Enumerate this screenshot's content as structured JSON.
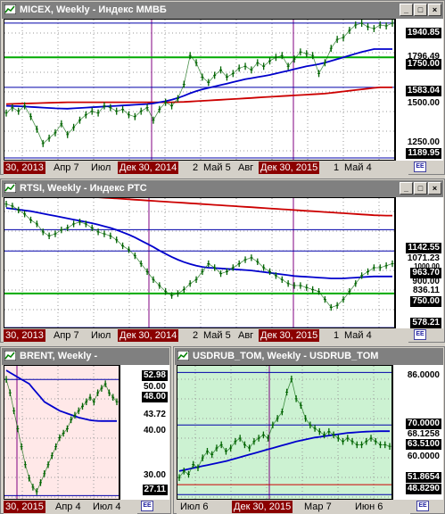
{
  "colors": {
    "title_bg_inactive": "#7f7f7f",
    "title_bg_active": "#7f7f7f",
    "plot_bg_white": "#ffffff",
    "plot_bg_pink": "#ffe8e8",
    "plot_bg_green": "#ccf2d2",
    "price": "#006400",
    "ma_blue": "#0000cc",
    "ma_red": "#cc0000",
    "level_green": "#00aa00",
    "level_blue": "#0000aa",
    "date_highlight": "#8b0000"
  },
  "window_buttons": {
    "minimize": "_",
    "maximize": "□",
    "close": "×"
  },
  "windows": {
    "micex": {
      "title": "MICEX, Weekly - Индекс ММВБ",
      "y_labels": [
        "1940.85",
        "1796.49",
        "1750.00",
        "1583.04",
        "1500.00",
        "1250.00",
        "1189.95"
      ],
      "x_labels": [
        "30, 2013",
        "Апр 7",
        "Июл",
        "Дек 30, 2014",
        "2",
        "Май 5",
        "Авг",
        "Дек 30, 2015",
        "1",
        "Май 4"
      ],
      "x_highlight": [
        0,
        3,
        7
      ],
      "corner_icon": "chart-settings-icon"
    },
    "rtsi": {
      "title": "RTSI, Weekly - Индекс РТС",
      "y_labels": [
        "1142.55",
        "1071.23",
        "1000.00",
        "963.70",
        "900.00",
        "836.11",
        "750.00",
        "578.21"
      ],
      "x_labels": [
        "30, 2013",
        "Апр 7",
        "Июл",
        "Дек 30, 2014",
        "2",
        "Май 5",
        "Авг",
        "Дек 30, 2015",
        "1",
        "Май 4"
      ],
      "x_highlight": [
        0,
        3,
        7
      ],
      "corner_icon": "chart-settings-icon"
    },
    "brent": {
      "title": "BRENT, Weekly -",
      "y_labels": [
        "52.98",
        "50.00",
        "48.00",
        "43.72",
        "40.00",
        "30.00",
        "27.11"
      ],
      "x_labels": [
        "30, 2015",
        "Апр 4",
        "Июл 4"
      ],
      "x_highlight": [
        0
      ],
      "corner_icon": "chart-settings-icon"
    },
    "usdrub": {
      "title": "USDRUB_TOM, Weekly - USDRUB_TOM",
      "y_labels": [
        "86.0000",
        "70.0000",
        "68.1258",
        "63.5100",
        "60.0000",
        "51.8654",
        "48.8290"
      ],
      "x_labels": [
        "Июл 6",
        "Дек 30, 2015",
        "Мар 7",
        "Июн 6"
      ],
      "x_highlight": [
        1
      ],
      "corner_icon": "chart-settings-icon"
    }
  },
  "chart_data": [
    {
      "type": "line",
      "title": "MICEX, Weekly - Индекс ММВБ",
      "ylim": [
        1170,
        1960
      ],
      "series": [
        {
          "name": "",
          "values": [
            1440,
            1470,
            1450,
            1480,
            1420,
            1350,
            1270,
            1300,
            1330,
            1380,
            1320,
            1360,
            1400,
            1430,
            1450,
            1440,
            1480,
            1470,
            1450,
            1460,
            1430,
            1420,
            1450,
            1470,
            1400,
            1460,
            1500,
            1480,
            1520,
            1600,
            1760,
            1720,
            1640,
            1610,
            1650,
            1680,
            1640,
            1660,
            1690,
            1700,
            1680,
            1720,
            1700,
            1730,
            1750,
            1760,
            1700,
            1740,
            1780,
            1770,
            1760,
            1660,
            1720,
            1800,
            1850,
            1860,
            1900,
            1930,
            1940,
            1920,
            1910,
            1930,
            1925,
            1940
          ]
        },
        {
          "name": "",
          "values": [
            1480,
            1479,
            1478,
            1476,
            1474,
            1472,
            1470,
            1468,
            1466,
            1465,
            1464,
            1466,
            1468,
            1470,
            1472,
            1474,
            1476,
            1478,
            1480,
            1482,
            1484,
            1486,
            1488,
            1490,
            1494,
            1500,
            1506,
            1514,
            1524,
            1536,
            1550,
            1562,
            1572,
            1580,
            1588,
            1596,
            1604,
            1612,
            1620,
            1628,
            1634,
            1640,
            1646,
            1652,
            1660,
            1668,
            1676,
            1684,
            1692,
            1700,
            1706,
            1712,
            1720,
            1730,
            1740,
            1750,
            1760,
            1770,
            1780,
            1788,
            1796,
            1796,
            1796,
            1796
          ]
        },
        {
          "name": "",
          "values": [
            1490,
            1491,
            1492,
            1493,
            1494,
            1495,
            1496,
            1497,
            1498,
            1499,
            1500,
            1500,
            1500,
            1500,
            1500,
            1500,
            1500,
            1500,
            1500,
            1500,
            1500,
            1500,
            1500,
            1500,
            1500,
            1500,
            1500,
            1500,
            1501,
            1502,
            1504,
            1506,
            1508,
            1510,
            1512,
            1514,
            1516,
            1518,
            1520,
            1522,
            1524,
            1526,
            1528,
            1530,
            1532,
            1534,
            1536,
            1538,
            1540,
            1542,
            1544,
            1546,
            1548,
            1552,
            1556,
            1560,
            1564,
            1568,
            1572,
            1576,
            1580,
            1583,
            1583,
            1583
          ]
        }
      ]
    },
    {
      "type": "line",
      "title": "RTSI, Weekly - Индекс РТС",
      "ylim": [
        570,
        1230
      ],
      "series": [
        {
          "name": "",
          "values": [
            1200,
            1190,
            1170,
            1150,
            1120,
            1100,
            1060,
            1040,
            1050,
            1070,
            1080,
            1100,
            1110,
            1100,
            1080,
            1060,
            1050,
            1040,
            1020,
            990,
            970,
            940,
            900,
            860,
            820,
            790,
            760,
            740,
            750,
            770,
            800,
            820,
            860,
            900,
            880,
            850,
            860,
            880,
            900,
            920,
            930,
            910,
            880,
            860,
            840,
            820,
            800,
            790,
            790,
            780,
            770,
            760,
            720,
            680,
            690,
            720,
            760,
            800,
            840,
            860,
            880,
            880,
            890,
            900
          ]
        },
        {
          "name": "",
          "values": [
            1180,
            1176,
            1172,
            1168,
            1164,
            1158,
            1152,
            1146,
            1140,
            1134,
            1128,
            1122,
            1116,
            1110,
            1104,
            1096,
            1088,
            1080,
            1070,
            1058,
            1046,
            1032,
            1016,
            1000,
            984,
            966,
            950,
            934,
            920,
            908,
            898,
            890,
            884,
            880,
            878,
            876,
            874,
            872,
            870,
            868,
            866,
            862,
            858,
            854,
            850,
            846,
            842,
            838,
            836,
            834,
            832,
            830,
            828,
            826,
            826,
            826,
            828,
            830,
            832,
            834,
            836,
            836,
            836,
            836
          ]
        },
        {
          "name": "",
          "values": [
            1250,
            1249,
            1248,
            1247,
            1246,
            1245,
            1244,
            1243,
            1242,
            1241,
            1240,
            1239,
            1238,
            1237,
            1236,
            1234,
            1232,
            1230,
            1228,
            1226,
            1224,
            1222,
            1220,
            1218,
            1216,
            1214,
            1212,
            1210,
            1208,
            1206,
            1204,
            1202,
            1200,
            1198,
            1196,
            1194,
            1192,
            1190,
            1188,
            1186,
            1184,
            1182,
            1180,
            1178,
            1176,
            1174,
            1172,
            1170,
            1168,
            1166,
            1164,
            1162,
            1160,
            1158,
            1156,
            1154,
            1152,
            1150,
            1148,
            1146,
            1144,
            1143,
            1142,
            1142
          ]
        }
      ]
    },
    {
      "type": "line",
      "title": "BRENT, Weekly -",
      "ylim": [
        26,
        56
      ],
      "series": [
        {
          "name": "",
          "values": [
            53,
            50,
            46,
            42,
            38,
            34,
            31,
            29,
            28,
            30,
            32,
            34,
            36,
            38,
            40,
            41,
            42,
            44,
            45,
            46,
            47,
            48,
            49,
            48,
            50,
            51,
            52,
            50,
            49,
            48
          ]
        },
        {
          "name": "",
          "values": [
            55,
            54.5,
            54,
            53.5,
            53,
            52.5,
            52,
            51,
            50,
            49,
            48,
            47.5,
            47,
            46.5,
            46,
            45.7,
            45.4,
            45.1,
            44.8,
            44.5,
            44.3,
            44.1,
            43.9,
            43.8,
            43.75,
            43.72,
            43.72,
            43.72,
            43.72,
            43.72
          ]
        }
      ]
    },
    {
      "type": "line",
      "title": "USDRUB_TOM, Weekly - USDRUB_TOM",
      "ylim": [
        47,
        88
      ],
      "series": [
        {
          "name": "",
          "values": [
            54,
            56,
            55,
            58,
            57,
            60,
            62,
            61,
            63,
            64,
            62,
            63,
            65,
            66,
            64,
            63,
            65,
            66,
            67,
            66,
            70,
            72,
            74,
            80,
            84,
            78,
            76,
            72,
            70,
            69,
            68,
            67,
            68,
            67,
            66,
            65,
            66,
            65,
            64,
            64,
            65,
            66,
            65,
            64,
            64,
            63.5
          ]
        },
        {
          "name": "",
          "values": [
            56,
            56.3,
            56.6,
            56.9,
            57.2,
            57.5,
            57.8,
            58.1,
            58.4,
            58.7,
            59,
            59.4,
            59.8,
            60.2,
            60.6,
            61,
            61.4,
            61.8,
            62.2,
            62.6,
            63,
            63.4,
            63.8,
            64.2,
            64.6,
            65,
            65.3,
            65.6,
            65.9,
            66.2,
            66.4,
            66.6,
            66.8,
            67,
            67.2,
            67.4,
            67.6,
            67.7,
            67.8,
            67.9,
            68,
            68.05,
            68.1,
            68.12,
            68.12,
            68.13
          ]
        }
      ]
    }
  ]
}
